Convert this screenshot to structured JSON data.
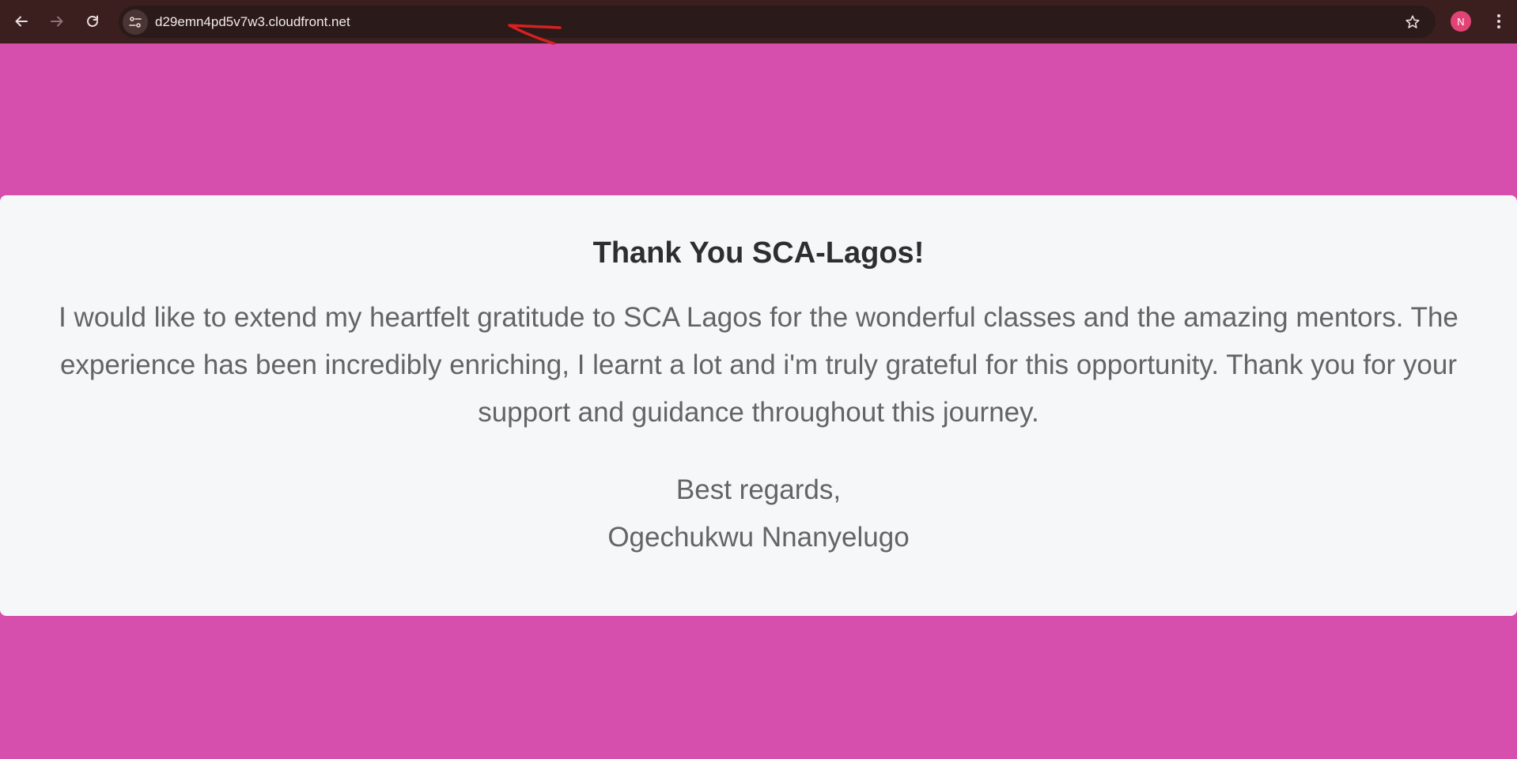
{
  "browser": {
    "url": "d29emn4pd5v7w3.cloudfront.net",
    "profile_initial": "N",
    "icons": {
      "back": "arrow-left-icon",
      "forward": "arrow-right-icon",
      "reload": "reload-icon",
      "site_info": "tune-icon",
      "bookmark": "star-icon",
      "menu": "kebab-menu-icon"
    },
    "colors": {
      "toolbar": "#3b1f1f",
      "omnibox": "#2a1a1a",
      "avatar": "#e24377",
      "annotation": "#d92020"
    }
  },
  "page": {
    "background": "#d74fac",
    "card_background": "#f6f7f9",
    "title": "Thank You SCA-Lagos!",
    "message": "I would like to extend my heartfelt gratitude to SCA Lagos for the wonderful classes and the amazing mentors. The experience has been incredibly enriching, I learnt a lot and i'm truly grateful for this opportunity. Thank you for your support and guidance throughout this journey.",
    "closing": "Best regards,",
    "signature": "Ogechukwu Nnanyelugo"
  }
}
